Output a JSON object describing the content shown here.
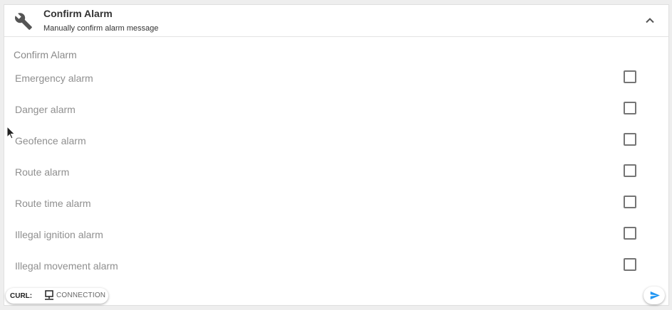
{
  "header": {
    "title": "Confirm Alarm",
    "subtitle": "Manually confirm alarm message",
    "icon": "wrench-icon",
    "collapse_icon": "chevron-up-icon"
  },
  "section_label": "Confirm Alarm",
  "options": [
    {
      "label": "Emergency alarm",
      "checked": false
    },
    {
      "label": "Danger alarm",
      "checked": false
    },
    {
      "label": "Geofence alarm",
      "checked": false
    },
    {
      "label": "Route alarm",
      "checked": false
    },
    {
      "label": "Route time alarm",
      "checked": false
    },
    {
      "label": "Illegal ignition alarm",
      "checked": false
    },
    {
      "label": "Illegal movement alarm",
      "checked": false
    }
  ],
  "footer": {
    "curl_label": "CURL:",
    "connection_label": "CONNECTION",
    "connection_icon": "monitor-icon",
    "send_icon": "send-icon"
  },
  "colors": {
    "accent": "#2196f3",
    "checkbox_border": "#757575",
    "label_text": "#8f8f8f"
  }
}
